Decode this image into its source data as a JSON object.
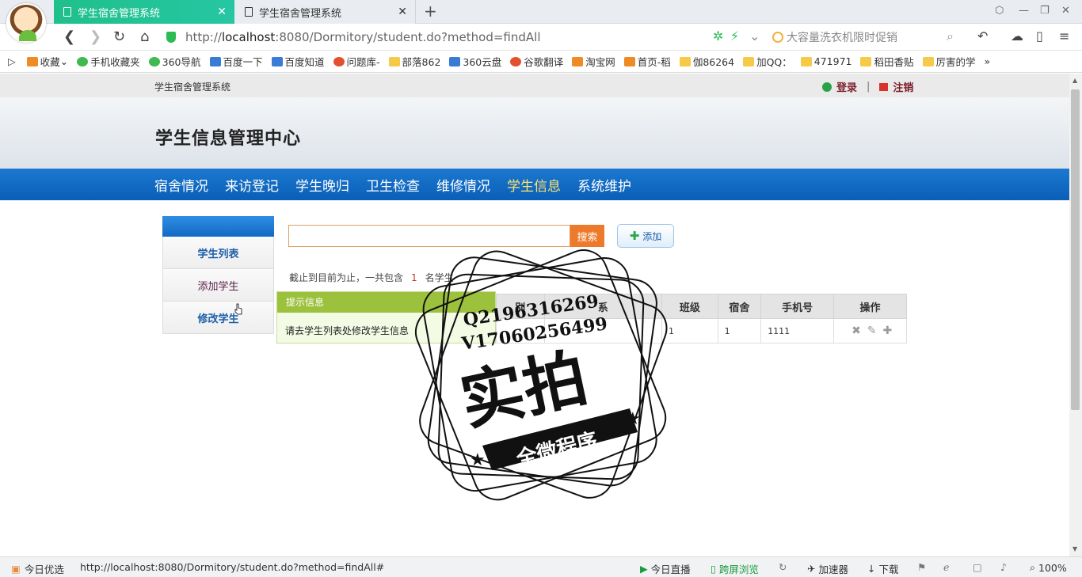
{
  "browser": {
    "tabs": [
      {
        "label": "学生宿舍管理系统",
        "active": true
      },
      {
        "label": "学生宿舍管理系统",
        "active": false
      }
    ],
    "url_prefix": "http://",
    "url_host": "localhost",
    "url_rest": ":8080/Dormitory/student.do?method=findAll",
    "search_placeholder": "大容量洗衣机限时促销",
    "bookmarks": [
      "收藏",
      "手机收藏夹",
      "360导航",
      "百度一下",
      "百度知道",
      "问题库-",
      "部落862",
      "360云盘",
      "谷歌翻译",
      "淘宝网",
      "首页-稻",
      "伽86264",
      "加QQ：",
      "471971",
      "稻田香贴",
      "厉害的学"
    ],
    "accent": "#1fc08a"
  },
  "site": {
    "name": "学生宿舍管理系统",
    "login": "登录",
    "logout": "注销",
    "heading": "学生信息管理中心",
    "nav": [
      "宿舍情况",
      "来访登记",
      "学生晚归",
      "卫生检查",
      "维修情况",
      "学生信息",
      "系统维护"
    ],
    "active_nav": "学生信息"
  },
  "sidebar": {
    "items": [
      "学生列表",
      "添加学生",
      "修改学生"
    ]
  },
  "toolbar": {
    "search_value": "",
    "search_label": "搜索",
    "add_label": "添加"
  },
  "summary": {
    "prefix": "截止到目前为止，一共包含",
    "count": "1",
    "suffix": "名学生"
  },
  "table": {
    "headers": [
      "别",
      "系",
      "班级",
      "宿舍",
      "手机号",
      "操作"
    ],
    "rows": [
      [
        "",
        "",
        "1",
        "1",
        "1111",
        ""
      ]
    ]
  },
  "tooltip": {
    "title": "提示信息",
    "message": "请去学生列表处修改学生信息"
  },
  "watermark": {
    "line1": "Q2196316269",
    "line2": "V17060256499",
    "main": "实拍",
    "banner": "全微程序"
  },
  "status": {
    "left": "今日优选",
    "url": "http://localhost:8080/Dormitory/student.do?method=findAll#",
    "live": "今日直播",
    "cross": "跨屏浏览",
    "accelerate": "加速器",
    "download": "下载",
    "zoom": "100%"
  }
}
